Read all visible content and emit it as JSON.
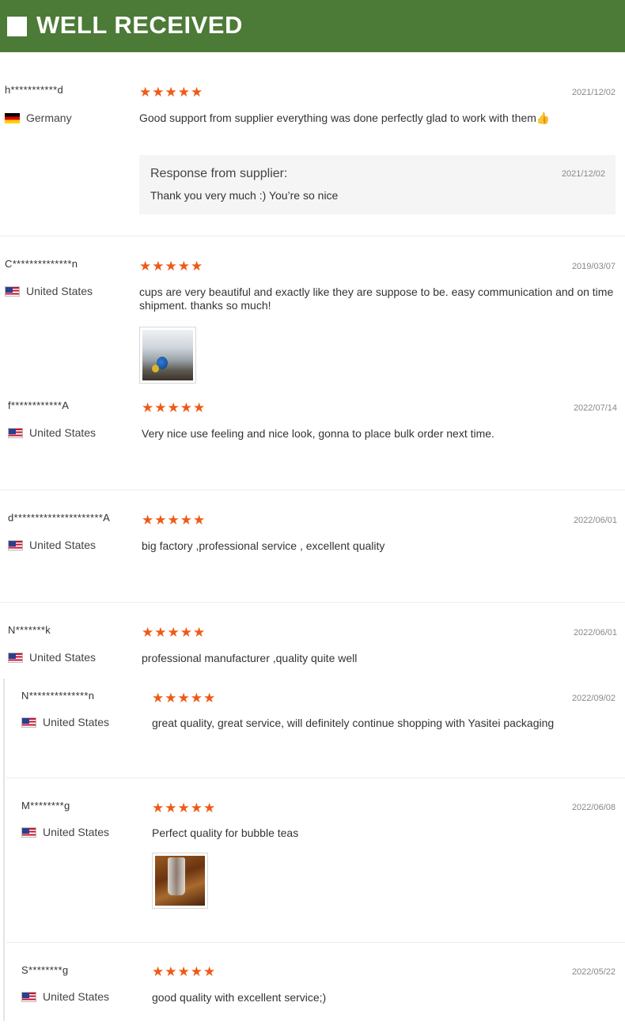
{
  "banner": {
    "title": "WELL RECEIVED"
  },
  "response_label": "Response from supplier:",
  "reviews": [
    {
      "user": "h***********d",
      "country": "Germany",
      "flag": "de",
      "stars": "★★★★★",
      "rating": 5,
      "date": "2021/12/02",
      "text": "Good support from supplier everything was done perfectly glad to work with them👍",
      "response": {
        "date": "2021/12/02",
        "text": "Thank you very much :) You’re so nice"
      }
    },
    {
      "user": "C**************n",
      "country": "United States",
      "flag": "us",
      "stars": "★★★★★",
      "rating": 5,
      "date": "2019/03/07",
      "text": "cups are very beautiful and exactly like they are suppose to be. easy communication and on time shipment. thanks so much!"
    },
    {
      "user": "f************A",
      "country": "United States",
      "flag": "us",
      "stars": "★★★★★",
      "rating": 5,
      "date": "2022/07/14",
      "text": "Very nice use feeling and nice look, gonna to place bulk order next time."
    },
    {
      "user": "d*********************A",
      "country": "United States",
      "flag": "us",
      "stars": "★★★★★",
      "rating": 5,
      "date": "2022/06/01",
      "text": "big factory ,professional service , excellent quality"
    },
    {
      "user": "N*******k",
      "country": "United States",
      "flag": "us",
      "stars": "★★★★★",
      "rating": 5,
      "date": "2022/06/01",
      "text": "professional manufacturer ,quality quite well"
    },
    {
      "user": "N**************n",
      "country": "United States",
      "flag": "us",
      "stars": "★★★★★",
      "rating": 5,
      "date": "2022/09/02",
      "text": "great quality, great service, will definitely continue shopping with Yasitei packaging"
    },
    {
      "user": "M********g",
      "country": "United States",
      "flag": "us",
      "stars": "★★★★★",
      "rating": 5,
      "date": "2022/06/08",
      "text": "Perfect quality for bubble teas"
    },
    {
      "user": "S********g",
      "country": "United States",
      "flag": "us",
      "stars": "★★★★★",
      "rating": 5,
      "date": "2022/05/22",
      "text": "good quality with excellent service;)"
    }
  ]
}
